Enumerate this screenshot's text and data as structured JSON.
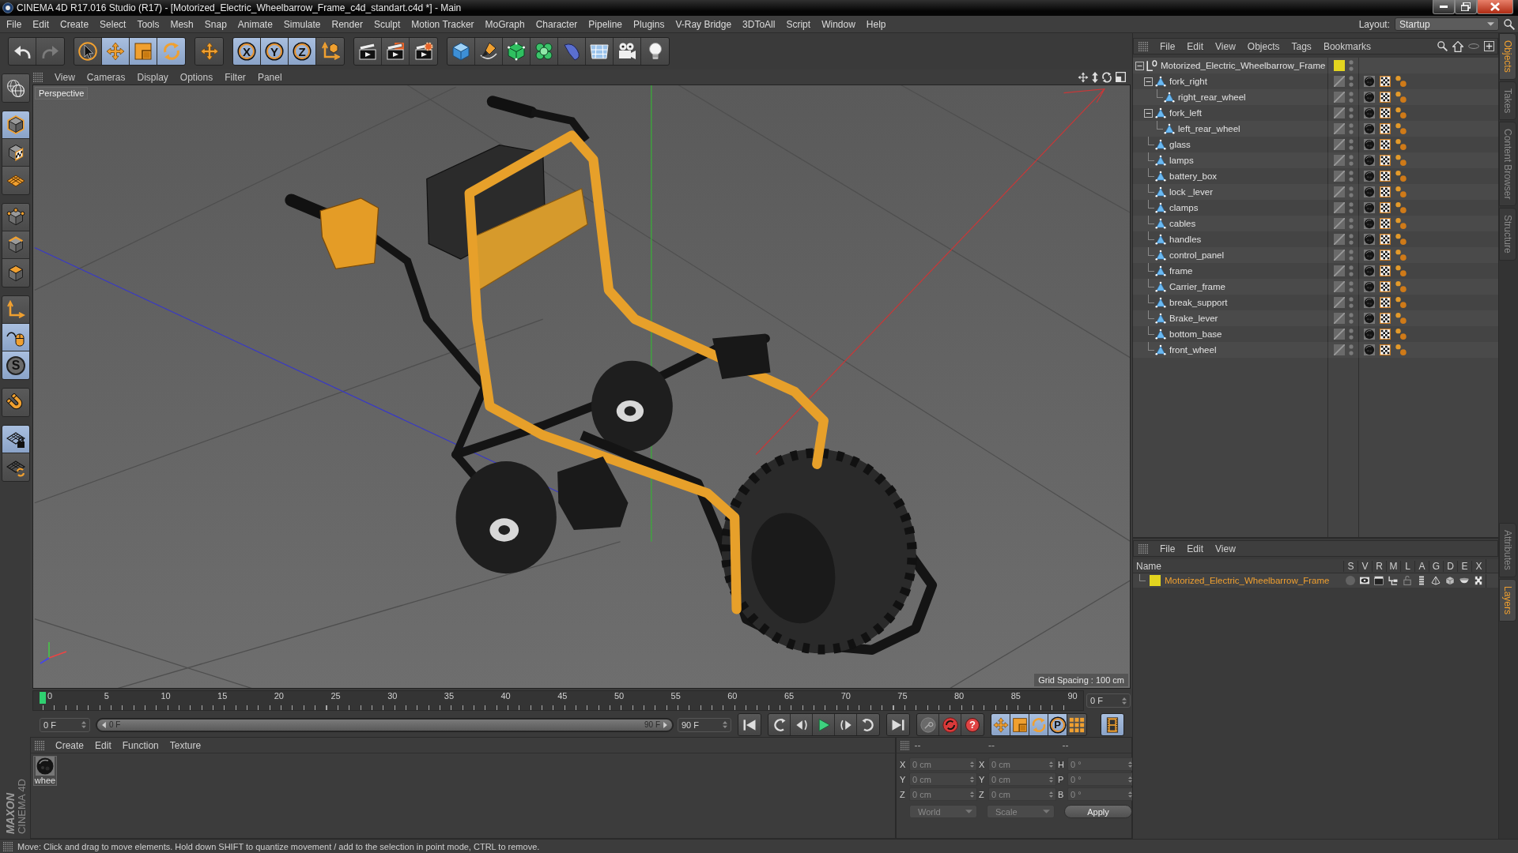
{
  "window": {
    "title": "CINEMA 4D R17.016 Studio (R17) - [Motorized_Electric_Wheelbarrow_Frame_c4d_standart.c4d *] - Main"
  },
  "menu_bar": {
    "items": [
      "File",
      "Edit",
      "Create",
      "Select",
      "Tools",
      "Mesh",
      "Snap",
      "Animate",
      "Simulate",
      "Render",
      "Sculpt",
      "Motion Tracker",
      "MoGraph",
      "Character",
      "Pipeline",
      "Plugins",
      "V-Ray Bridge",
      "3DToAll",
      "Script",
      "Window",
      "Help"
    ],
    "layout_label": "Layout:",
    "layout_value": "Startup"
  },
  "toolbar": {
    "groups": [
      {
        "tools": [
          {
            "kind": "undo",
            "selected": false,
            "disabled": false
          },
          {
            "kind": "redo",
            "selected": false,
            "disabled": true
          }
        ]
      },
      {
        "tools": [
          {
            "kind": "select",
            "selected": false,
            "disabled": false
          },
          {
            "kind": "move",
            "selected": true,
            "disabled": false
          },
          {
            "kind": "scale",
            "selected": true,
            "disabled": false
          },
          {
            "kind": "rotate",
            "selected": true,
            "disabled": false
          }
        ]
      },
      {
        "tools": [
          {
            "kind": "recent",
            "selected": false,
            "disabled": false
          }
        ]
      },
      {
        "tools": [
          {
            "kind": "axis",
            "label": "X",
            "selected": true,
            "disabled": false
          },
          {
            "kind": "axis",
            "label": "Y",
            "selected": true,
            "disabled": false
          },
          {
            "kind": "axis",
            "label": "Z",
            "selected": true,
            "disabled": false
          },
          {
            "kind": "coords",
            "selected": false,
            "disabled": false
          }
        ]
      },
      {
        "tools": [
          {
            "kind": "render-view",
            "selected": false,
            "disabled": false
          },
          {
            "kind": "render-picture",
            "selected": false,
            "disabled": false
          },
          {
            "kind": "render-settings",
            "selected": false,
            "disabled": false
          }
        ]
      },
      {
        "tools": [
          {
            "kind": "cube",
            "selected": false,
            "disabled": false
          },
          {
            "kind": "pen",
            "selected": false,
            "disabled": false
          },
          {
            "kind": "subdivision",
            "selected": false,
            "disabled": false
          },
          {
            "kind": "cloner",
            "selected": false,
            "disabled": false
          },
          {
            "kind": "deformer",
            "selected": false,
            "disabled": false
          },
          {
            "kind": "floor",
            "selected": false,
            "disabled": false
          },
          {
            "kind": "camera",
            "selected": false,
            "disabled": false
          },
          {
            "kind": "light",
            "selected": false,
            "disabled": false
          }
        ]
      }
    ]
  },
  "mode_toolbar": {
    "groups": [
      {
        "tools": [
          {
            "kind": "editable",
            "selected": false
          }
        ]
      },
      {
        "tools": [
          {
            "kind": "model",
            "selected": true
          },
          {
            "kind": "texture",
            "selected": false
          },
          {
            "kind": "workplane",
            "selected": false
          }
        ]
      },
      {
        "tools": [
          {
            "kind": "points",
            "selected": false
          },
          {
            "kind": "edges",
            "selected": false
          },
          {
            "kind": "polygons",
            "selected": false
          }
        ]
      },
      {
        "tools": [
          {
            "kind": "axis-mode",
            "selected": false
          },
          {
            "kind": "tweak",
            "selected": true
          },
          {
            "kind": "snap",
            "label": "S",
            "selected": true
          }
        ]
      },
      {
        "tools": [
          {
            "kind": "magnet",
            "selected": false
          }
        ]
      },
      {
        "tools": [
          {
            "kind": "grid-lock",
            "selected": true
          },
          {
            "kind": "grid-rotate",
            "selected": false
          }
        ]
      }
    ]
  },
  "logo": {
    "brand": "MAXON",
    "product": "CINEMA 4D"
  },
  "viewport": {
    "menu": [
      "View",
      "Cameras",
      "Display",
      "Options",
      "Filter",
      "Panel"
    ],
    "camera_label": "Perspective",
    "grid_spacing": "Grid Spacing : 100 cm"
  },
  "timeline": {
    "ticks": [
      "0",
      "5",
      "10",
      "15",
      "20",
      "25",
      "30",
      "35",
      "40",
      "45",
      "50",
      "55",
      "60",
      "65",
      "70",
      "75",
      "80",
      "85",
      "90"
    ],
    "level": 0,
    "current_frame": "0 F"
  },
  "transport": {
    "start_field": "0 F",
    "range": {
      "start": "0 F",
      "end": "90 F",
      "level": 1
    },
    "end_field": "90 F",
    "groups": [
      {
        "buttons": [
          {
            "kind": "go-start",
            "selected": false
          }
        ]
      },
      {
        "buttons": [
          {
            "kind": "prev-key",
            "selected": false
          },
          {
            "kind": "prev-frame",
            "selected": false
          },
          {
            "kind": "play",
            "selected": false
          },
          {
            "kind": "next-frame",
            "selected": false
          },
          {
            "kind": "next-key",
            "selected": false
          }
        ]
      },
      {
        "buttons": [
          {
            "kind": "go-end",
            "selected": false
          }
        ]
      },
      {
        "buttons": [
          {
            "kind": "key",
            "selected": false
          },
          {
            "kind": "autokey",
            "selected": false
          },
          {
            "kind": "help",
            "label": "?",
            "selected": false
          }
        ]
      },
      {
        "buttons": [
          {
            "kind": "key-move",
            "selected": true
          },
          {
            "kind": "key-scale",
            "selected": true
          },
          {
            "kind": "key-rotate",
            "selected": true
          },
          {
            "kind": "param",
            "label": "P",
            "selected": true
          },
          {
            "kind": "key-points",
            "selected": false
          }
        ]
      },
      {
        "buttons": [
          {
            "kind": "film",
            "selected": true
          }
        ]
      }
    ]
  },
  "materials": {
    "menu": [
      "Create",
      "Edit",
      "Function",
      "Texture"
    ],
    "items": [
      {
        "name": "whee"
      }
    ]
  },
  "coordinates": {
    "headers": [
      "--",
      "--",
      "--"
    ],
    "disabled": true,
    "rows": [
      {
        "label": "X",
        "position": "0 cm",
        "size_label": "X",
        "size": "0 cm",
        "rotation_label": "H",
        "rotation": "0 °"
      },
      {
        "label": "Y",
        "position": "0 cm",
        "size_label": "Y",
        "size": "0 cm",
        "rotation_label": "P",
        "rotation": "0 °"
      },
      {
        "label": "Z",
        "position": "0 cm",
        "size_label": "Z",
        "size": "0 cm",
        "rotation_label": "B",
        "rotation": "0 °"
      }
    ],
    "mode": "World",
    "size_mode": "Scale",
    "apply": "Apply"
  },
  "object_manager": {
    "menu": [
      "File",
      "Edit",
      "View",
      "Objects",
      "Tags",
      "Bookmarks"
    ],
    "objects": [
      {
        "name": "Motorized_Electric_Wheelbarrow_Frame",
        "kind": "null",
        "color": "#e3d51f",
        "expanded": true,
        "children": [
          {
            "name": "fork_right",
            "kind": "polygon",
            "expanded": true,
            "tags": [
              {
                "kind": "material"
              },
              {
                "kind": "uvw"
              },
              {
                "kind": "phong"
              }
            ],
            "children": [
              {
                "name": "right_rear_wheel",
                "kind": "polygon",
                "tags": [
                  {
                    "kind": "material"
                  },
                  {
                    "kind": "uvw"
                  },
                  {
                    "kind": "phong"
                  }
                ]
              }
            ]
          },
          {
            "name": "fork_left",
            "kind": "polygon",
            "expanded": true,
            "tags": [
              {
                "kind": "material"
              },
              {
                "kind": "uvw"
              },
              {
                "kind": "phong"
              }
            ],
            "children": [
              {
                "name": "left_rear_wheel",
                "kind": "polygon",
                "tags": [
                  {
                    "kind": "material"
                  },
                  {
                    "kind": "uvw"
                  },
                  {
                    "kind": "phong"
                  }
                ]
              }
            ]
          },
          {
            "name": "glass",
            "kind": "polygon",
            "tags": [
              {
                "kind": "material"
              },
              {
                "kind": "uvw"
              },
              {
                "kind": "phong"
              }
            ]
          },
          {
            "name": "lamps",
            "kind": "polygon",
            "tags": [
              {
                "kind": "material"
              },
              {
                "kind": "uvw"
              },
              {
                "kind": "phong"
              }
            ]
          },
          {
            "name": "battery_box",
            "kind": "polygon",
            "tags": [
              {
                "kind": "material"
              },
              {
                "kind": "uvw"
              },
              {
                "kind": "phong"
              }
            ]
          },
          {
            "name": "lock _lever",
            "kind": "polygon",
            "tags": [
              {
                "kind": "material"
              },
              {
                "kind": "uvw"
              },
              {
                "kind": "phong"
              }
            ]
          },
          {
            "name": "clamps",
            "kind": "polygon",
            "tags": [
              {
                "kind": "material"
              },
              {
                "kind": "uvw"
              },
              {
                "kind": "phong"
              }
            ]
          },
          {
            "name": "cables",
            "kind": "polygon",
            "tags": [
              {
                "kind": "material"
              },
              {
                "kind": "uvw"
              },
              {
                "kind": "phong"
              }
            ]
          },
          {
            "name": "handles",
            "kind": "polygon",
            "tags": [
              {
                "kind": "material"
              },
              {
                "kind": "uvw"
              },
              {
                "kind": "phong"
              }
            ]
          },
          {
            "name": "control_panel",
            "kind": "polygon",
            "tags": [
              {
                "kind": "material"
              },
              {
                "kind": "uvw"
              },
              {
                "kind": "phong"
              }
            ]
          },
          {
            "name": "frame",
            "kind": "polygon",
            "tags": [
              {
                "kind": "material"
              },
              {
                "kind": "uvw"
              },
              {
                "kind": "phong"
              }
            ]
          },
          {
            "name": "Carrier_frame",
            "kind": "polygon",
            "tags": [
              {
                "kind": "material"
              },
              {
                "kind": "uvw"
              },
              {
                "kind": "phong"
              }
            ]
          },
          {
            "name": "break_support",
            "kind": "polygon",
            "tags": [
              {
                "kind": "material"
              },
              {
                "kind": "uvw"
              },
              {
                "kind": "phong"
              }
            ]
          },
          {
            "name": "Brake_lever",
            "kind": "polygon",
            "tags": [
              {
                "kind": "material"
              },
              {
                "kind": "uvw"
              },
              {
                "kind": "phong"
              }
            ]
          },
          {
            "name": "bottom_base",
            "kind": "polygon",
            "tags": [
              {
                "kind": "material"
              },
              {
                "kind": "uvw"
              },
              {
                "kind": "phong"
              }
            ]
          },
          {
            "name": "front_wheel",
            "kind": "polygon",
            "tags": [
              {
                "kind": "material"
              },
              {
                "kind": "uvw"
              },
              {
                "kind": "phong"
              }
            ]
          }
        ]
      }
    ]
  },
  "layer_manager": {
    "menu": [
      "File",
      "Edit",
      "View"
    ],
    "columns": [
      "Name",
      "S",
      "V",
      "R",
      "M",
      "L",
      "A",
      "G",
      "D",
      "E",
      "X"
    ],
    "layers": [
      {
        "name": "Motorized_Electric_Wheelbarrow_Frame",
        "color": "#e3d51f",
        "flags": {
          "solo": false,
          "view": true,
          "render": true,
          "manager": true,
          "locked": false,
          "animation": true,
          "generators": true,
          "deformers": true,
          "expressions": true,
          "xref": true
        }
      }
    ]
  },
  "side_tabs": {
    "top": [
      {
        "label": "Objects",
        "selected": true
      },
      {
        "label": "Takes",
        "selected": false
      },
      {
        "label": "Content Browser",
        "selected": false
      },
      {
        "label": "Structure",
        "selected": false
      }
    ],
    "bottom": [
      {
        "label": "Attributes",
        "selected": false
      },
      {
        "label": "Layers",
        "selected": true
      }
    ]
  },
  "status_bar": {
    "text": "Move: Click and drag to move elements. Hold down SHIFT to quantize movement / add to the selection in point mode, CTRL to remove."
  }
}
